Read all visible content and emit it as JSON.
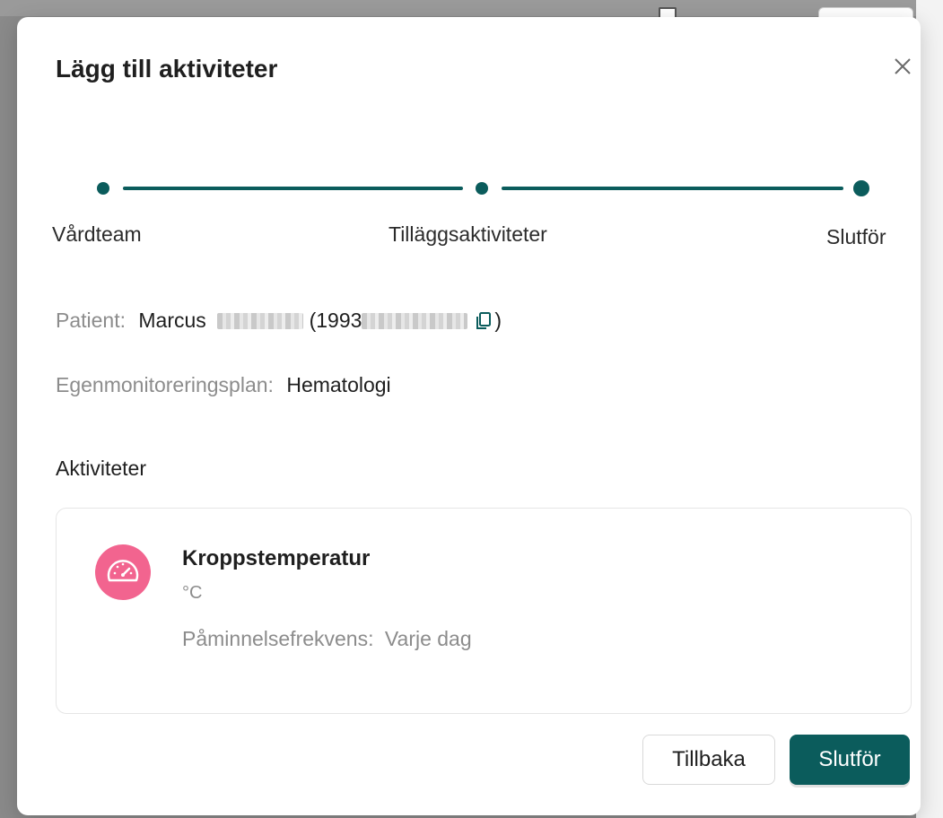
{
  "modal": {
    "title": "Lägg till aktiviteter",
    "close_icon": "close-icon"
  },
  "stepper": {
    "steps": [
      {
        "label": "Vårdteam"
      },
      {
        "label": "Tilläggsaktiviteter"
      },
      {
        "label": "Slutför"
      }
    ],
    "active_color": "#0b5c5c"
  },
  "patient": {
    "label": "Patient",
    "colon": ":",
    "first_name": "Marcus",
    "id_prefix": "(1993",
    "close_paren": ")",
    "copy_icon": "copy-icon"
  },
  "plan": {
    "label": "Egenmonitoreringsplan",
    "colon": ":",
    "value": "Hematologi"
  },
  "activities": {
    "title": "Aktiviteter",
    "items": [
      {
        "icon": "gauge-icon",
        "icon_color": "#f2648f",
        "name": "Kroppstemperatur",
        "unit": "°C",
        "reminder_label": "Påminnelsefrekvens",
        "reminder_colon": ":",
        "reminder_value": "Varje dag"
      }
    ]
  },
  "footer": {
    "back_label": "Tillbaka",
    "finish_label": "Slutför"
  }
}
